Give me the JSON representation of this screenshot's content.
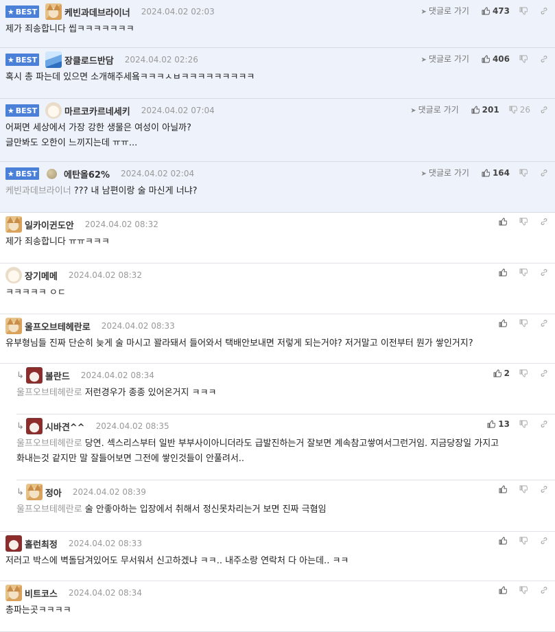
{
  "labels": {
    "best": "BEST",
    "goto_reply": "댓글로 가기"
  },
  "colors": {
    "best_badge": "#4a80d8",
    "best_bg": "#eef2fa"
  },
  "comments": [
    {
      "nick": "케빈과데브라이너",
      "date": "2024.04.02 02:03",
      "likes": "473",
      "dislikes": "",
      "body": "제가 죄송합니다 씹ㅋㅋㅋㅋㅋㅋㅋ",
      "body2": ""
    },
    {
      "nick": "장클로드반담",
      "date": "2024.04.02 02:26",
      "likes": "406",
      "dislikes": "",
      "body": "혹시 총 파는데 있으면 소개해주세욬ㅋㅋㅋㅅㅂㅋㅋㅋㅋㅋㅋㅋㅋㅋ",
      "body2": ""
    },
    {
      "nick": "마르코카르네세키",
      "date": "2024.04.02 07:04",
      "likes": "201",
      "dislikes": "26",
      "body": "어쩌면 세상에서 가장 강한 생물은 여성이 아닐까?",
      "body2": "글만봐도 오한이 느끼지는데 ㅠㅠ..."
    },
    {
      "nick": "에탄올62%",
      "date": "2024.04.02 02:04",
      "likes": "164",
      "dislikes": "",
      "mention": "케빈과데브라이너",
      "body": "??? 내 남편이랑 술 마신게 너냐?",
      "body2": ""
    },
    {
      "nick": "일카이귄도안",
      "date": "2024.04.02 08:32",
      "likes": "",
      "dislikes": "",
      "body": "제가 죄송합니다 ㅠㅠㅋㅋㅋ",
      "body2": ""
    },
    {
      "nick": "장기메메",
      "date": "2024.04.02 08:32",
      "likes": "",
      "dislikes": "",
      "body": "ㅋㅋㅋㅋㅋ ㅇㄷ",
      "body2": ""
    },
    {
      "nick": "울프오브테헤란로",
      "date": "2024.04.02 08:33",
      "likes": "",
      "dislikes": "",
      "body": "유부형님들 진짜 단순히 늦게 술 마시고 꽐라돼서 들어와서 택배안보내면 저렇게 되는거야? 저거말고 이전부터 뭔가 쌓인거지?",
      "body2": ""
    },
    {
      "nick": "볼란드",
      "date": "2024.04.02 08:34",
      "likes": "2",
      "dislikes": "",
      "mention": "울프오브테헤란로",
      "body": "저런경우가 종종 있어온거지 ㅋㅋㅋ",
      "body2": ""
    },
    {
      "nick": "시바견^^",
      "date": "2024.04.02 08:35",
      "likes": "13",
      "dislikes": "",
      "mention": "울프오브테헤란로",
      "body": "당연. 섹스리스부터 일반 부부사이아니더라도 급발진하는거 잘보면 계속참고쌓여서그런거임. 지금당장일 가지고",
      "body2": "화내는것 같지만 말 잘들어보면 그전에 쌓인것들이 안풀려서.."
    },
    {
      "nick": "정아",
      "date": "2024.04.02 08:39",
      "likes": "",
      "dislikes": "",
      "mention": "울프오브테헤란로",
      "body": "술 안좋아하는 입장에서 취해서 정신못차리는거 보면 진짜 극혐임",
      "body2": ""
    },
    {
      "nick": "홀런최정",
      "date": "2024.04.02 08:33",
      "likes": "",
      "dislikes": "",
      "body": "저러고 박스에 벽돌담겨있어도 무서워서 신고하겠냐 ㅋㅋ.. 내주소랑 연락처 다 아는데.. ㅋㅋ",
      "body2": ""
    },
    {
      "nick": "비트코스",
      "date": "2024.04.02 08:34",
      "likes": "",
      "dislikes": "",
      "body": "총파는곳ㅋㅋㅋㅋ",
      "body2": ""
    }
  ]
}
